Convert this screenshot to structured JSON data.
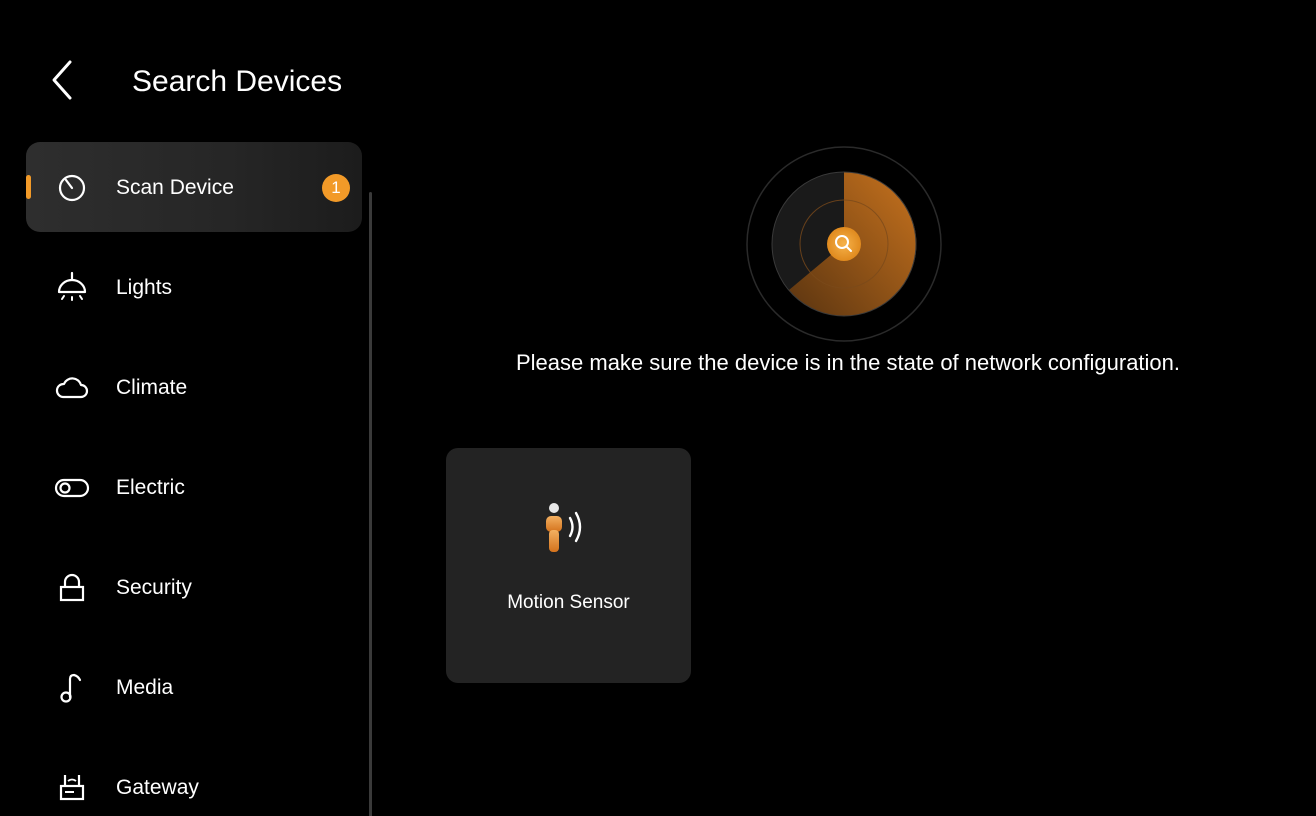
{
  "header": {
    "title": "Search Devices",
    "back_icon": "chevron-left-icon"
  },
  "sidebar": {
    "items": [
      {
        "label": "Scan Device",
        "icon": "scan-timer-icon",
        "active": true,
        "badge": "1"
      },
      {
        "label": "Lights",
        "icon": "ceiling-lamp-icon",
        "active": false
      },
      {
        "label": "Climate",
        "icon": "cloud-icon",
        "active": false
      },
      {
        "label": "Electric",
        "icon": "toggle-switch-icon",
        "active": false
      },
      {
        "label": "Security",
        "icon": "lock-icon",
        "active": false
      },
      {
        "label": "Media",
        "icon": "music-note-icon",
        "active": false
      },
      {
        "label": "Gateway",
        "icon": "gateway-router-icon",
        "active": false
      }
    ]
  },
  "main": {
    "scan_icon": "radar-search-icon",
    "hint": "Please make sure the device is in the state of network configuration.",
    "devices": [
      {
        "label": "Motion Sensor",
        "icon": "motion-sensor-icon"
      }
    ]
  },
  "colors": {
    "accent": "#f29a28",
    "background": "#000000",
    "card": "#232323"
  }
}
